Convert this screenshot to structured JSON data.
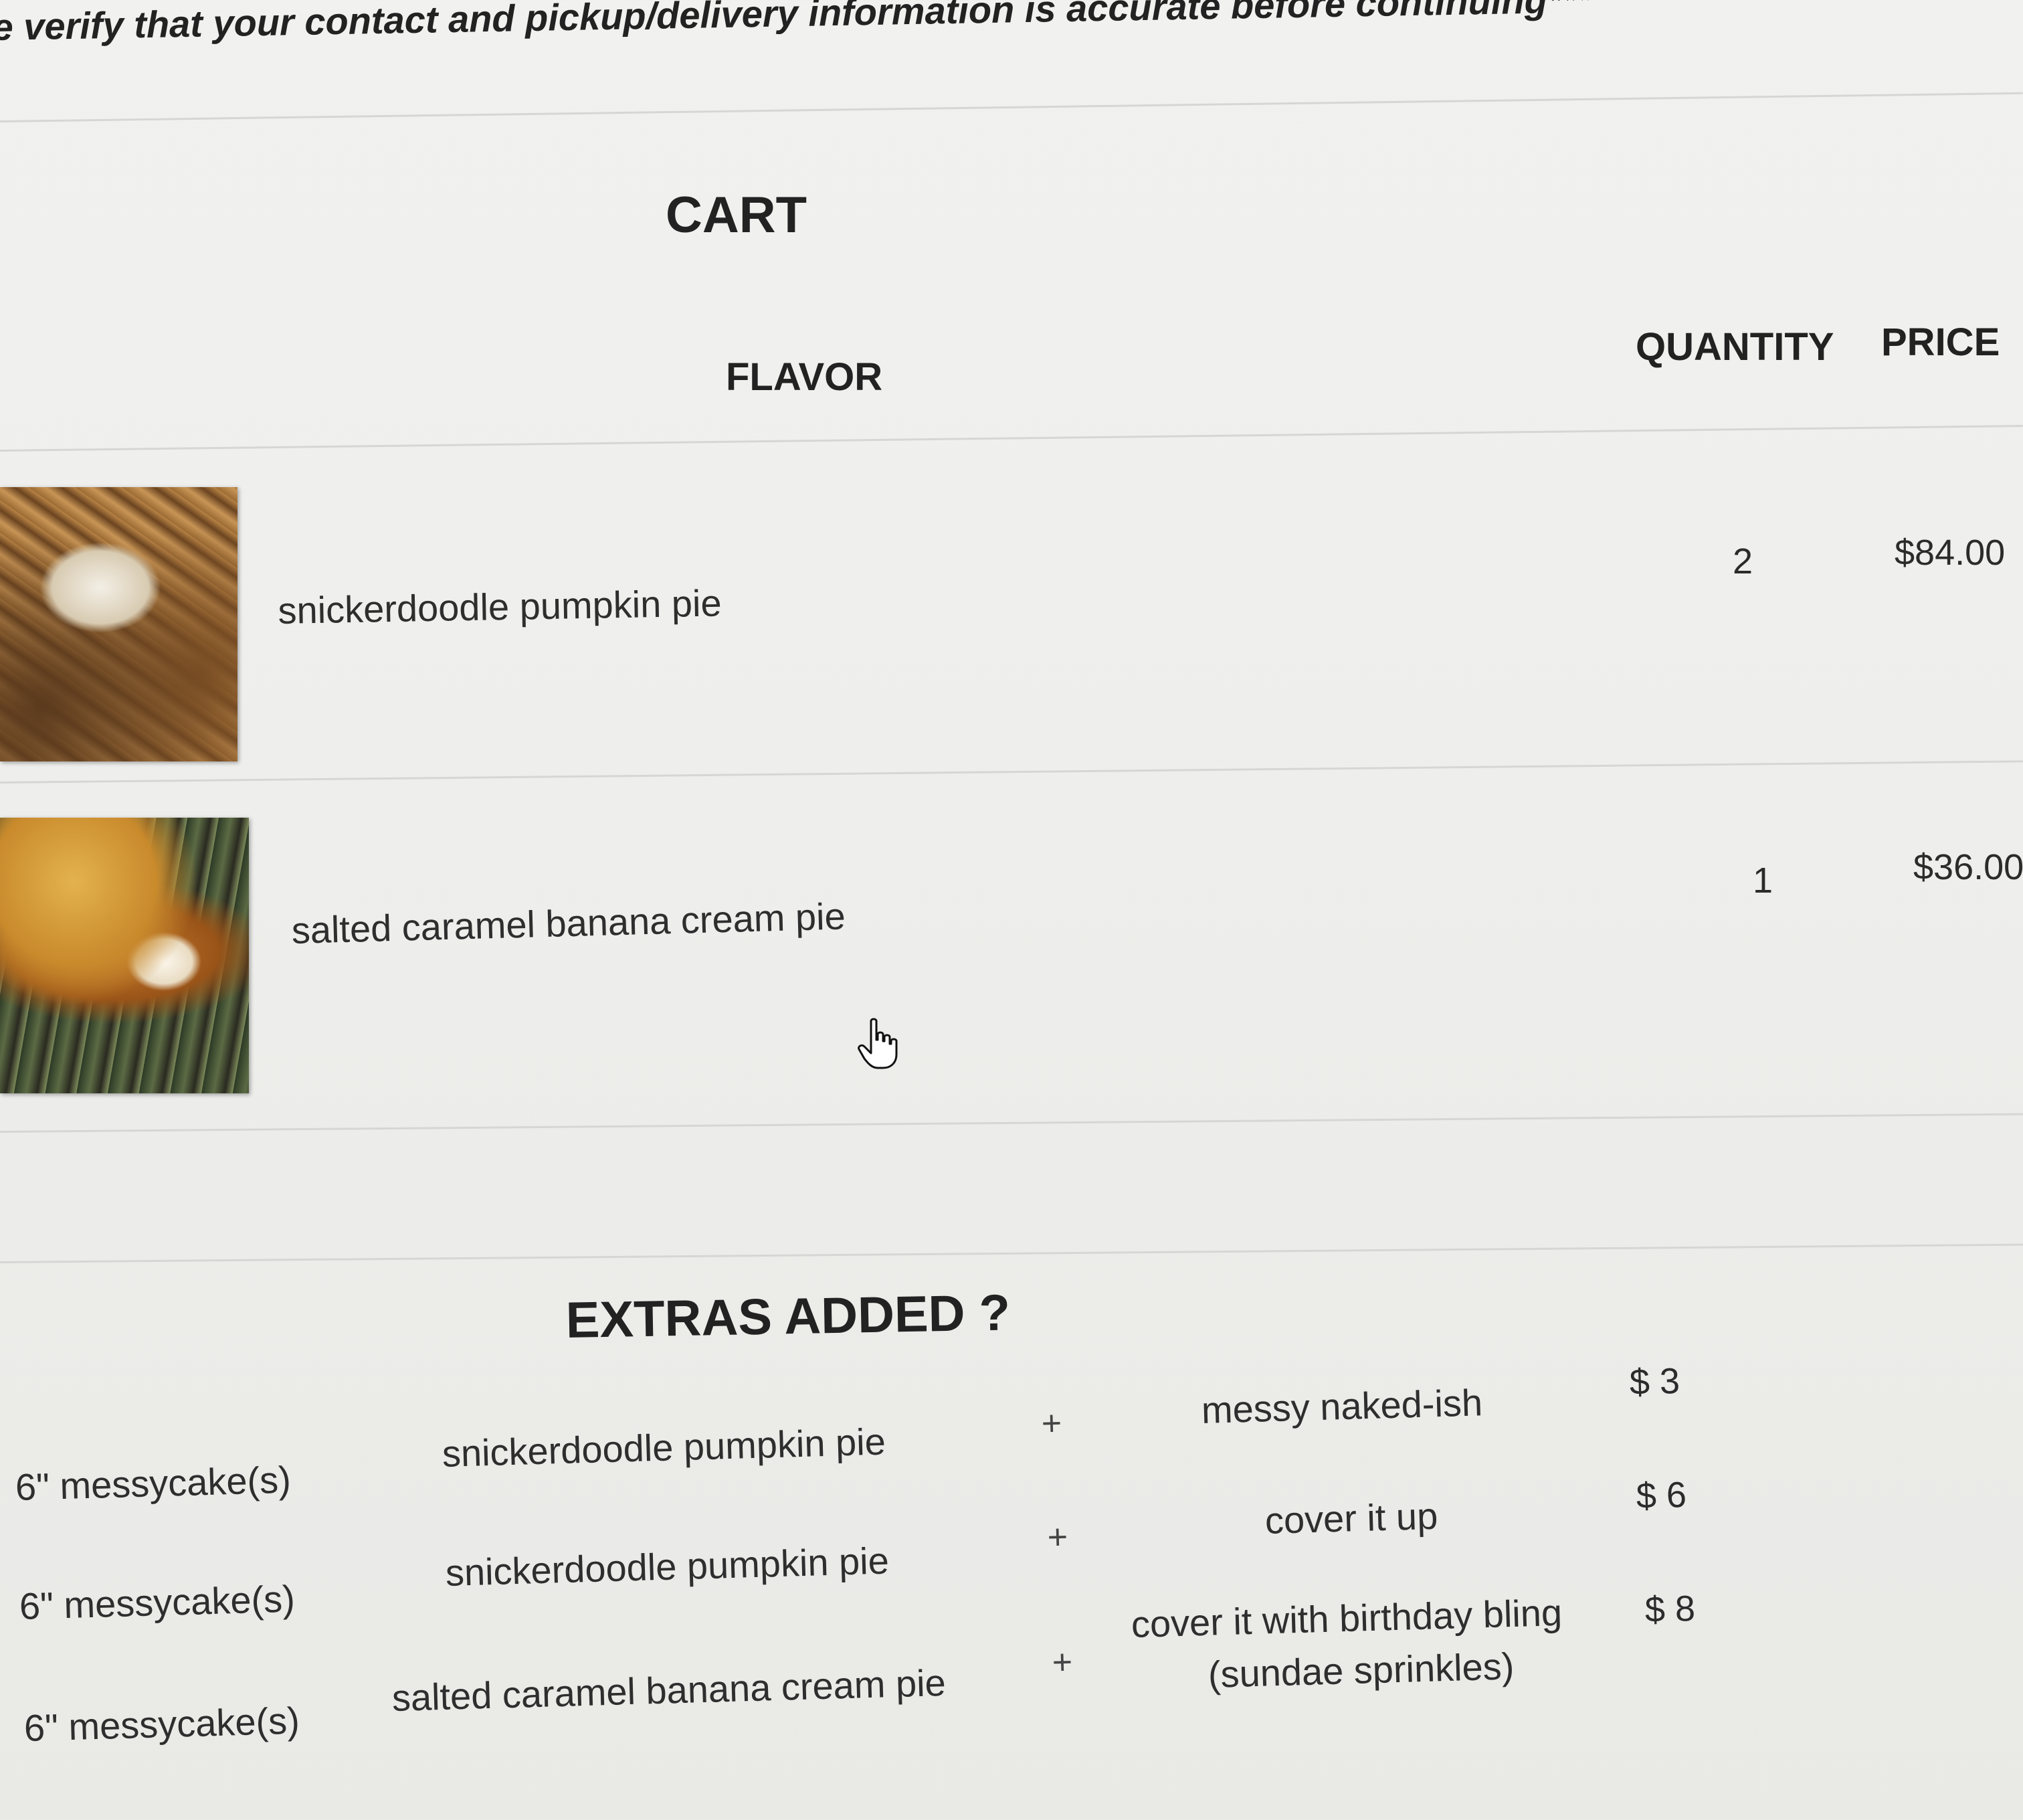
{
  "notice": "e verify that your contact and pickup/delivery information is accurate before continuing***",
  "cart": {
    "title": "CART",
    "columns": {
      "flavor": "FLAVOR",
      "quantity": "QUANTITY",
      "price": "PRICE"
    },
    "items": [
      {
        "name": "snickerdoodle pumpkin pie",
        "quantity": "2",
        "price": "$84.00"
      },
      {
        "name": "salted caramel banana cream pie",
        "quantity": "1",
        "price": "$36.00"
      }
    ]
  },
  "extras": {
    "title": "EXTRAS ADDED ?",
    "rows": [
      {
        "size": "6\" messycake(s)",
        "flavor": "snickerdoodle pumpkin pie",
        "plus": "+",
        "extra": "messy naked-ish",
        "price": "$ 3"
      },
      {
        "size": "6\" messycake(s)",
        "flavor": "snickerdoodle pumpkin pie",
        "plus": "+",
        "extra": "cover it up",
        "price": "$ 6"
      },
      {
        "size": "6\" messycake(s)",
        "flavor": "salted caramel banana cream pie",
        "plus": "+",
        "extra_line1": "cover it with birthday bling",
        "extra_line2": "(sundae sprinkles)",
        "price": "$ 8"
      }
    ]
  },
  "icons": {
    "cursor": "hand-pointer-icon",
    "thumbnails": [
      "pie-photo",
      "pie-photo"
    ]
  }
}
